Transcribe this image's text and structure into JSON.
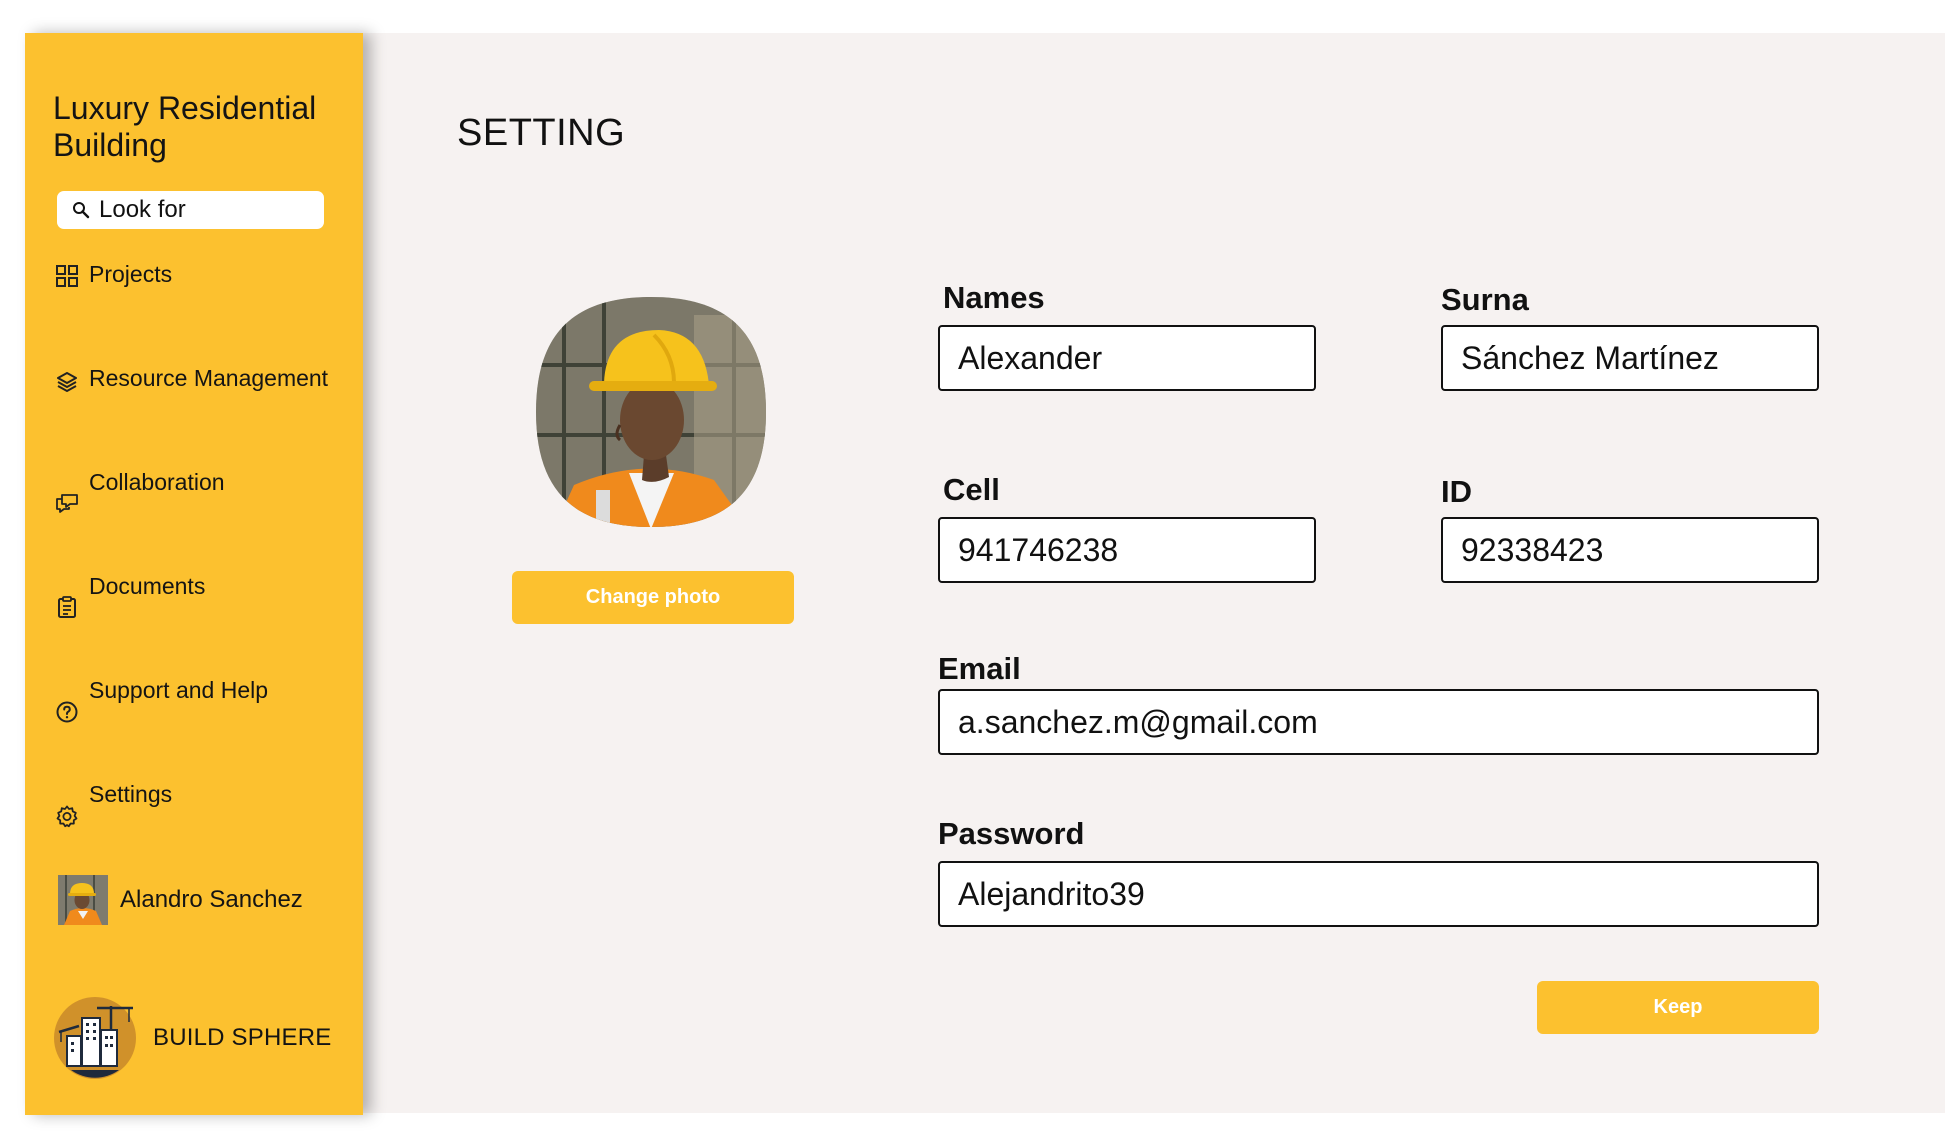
{
  "sidebar": {
    "project_title": "Luxury Residential Building",
    "search": {
      "placeholder": "Look for",
      "icon": "search-icon"
    },
    "items": [
      {
        "label": "Projects",
        "icon": "grid-icon"
      },
      {
        "label": "Resource Management",
        "icon": "layers-icon"
      },
      {
        "label": "Collaboration",
        "icon": "chat-icon"
      },
      {
        "label": "Documents",
        "icon": "clipboard-icon"
      },
      {
        "label": "Support and Help",
        "icon": "help-circle-icon"
      },
      {
        "label": "Settings",
        "icon": "gear-icon"
      }
    ],
    "user": {
      "name": "Alandro Sanchez"
    },
    "brand": {
      "name": "BUILD SPHERE"
    }
  },
  "main": {
    "title": "SETTING",
    "change_photo_label": "Change photo",
    "fields": {
      "names": {
        "label": "Names",
        "value": "Alexander"
      },
      "surname": {
        "label": "Surna",
        "value": "Sánchez Martínez"
      },
      "cell": {
        "label": "Cell",
        "value": "941746238"
      },
      "id": {
        "label": "ID",
        "value": "92338423"
      },
      "email": {
        "label": "Email",
        "value": "a.sanchez.m@gmail.com"
      },
      "password": {
        "label": "Password",
        "value": "Alejandrito39"
      }
    },
    "keep_label": "Keep"
  },
  "colors": {
    "accent": "#fcc12f",
    "background": "#f6f2f1",
    "text": "#111111"
  }
}
